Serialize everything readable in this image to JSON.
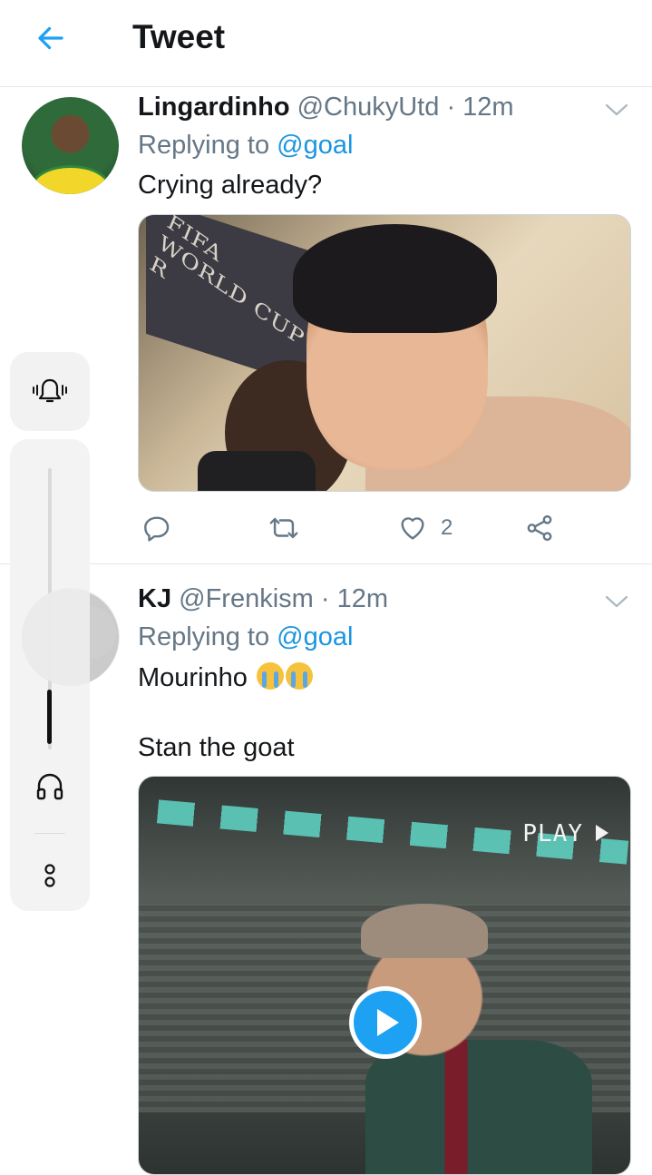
{
  "header": {
    "back_icon": "arrow-left-icon",
    "title": "Tweet",
    "accent": "#1da1f2"
  },
  "tweets": [
    {
      "name": "Lingardinho",
      "handle": "@ChukyUtd",
      "separator": "·",
      "time": "12m",
      "replying_prefix": "Replying to",
      "replying_to": "@goal",
      "text": "Crying already?",
      "media": {
        "type": "image",
        "sign_text": "FIFA WORLD CUP R"
      },
      "actions": {
        "reply_icon": "reply-icon",
        "retweet_icon": "retweet-icon",
        "like_icon": "heart-icon",
        "like_count": "2",
        "share_icon": "share-icon"
      }
    },
    {
      "name": "KJ",
      "handle": "@Frenkism",
      "separator": "·",
      "time": "12m",
      "replying_prefix": "Replying to",
      "replying_to": "@goal",
      "text_line1": "Mourinho",
      "emojis": [
        "crying-face-emoji",
        "crying-face-emoji"
      ],
      "text_line2": "Stan the goat",
      "media": {
        "type": "video",
        "overlay_label": "PLAY",
        "play_icon": "play-icon"
      }
    }
  ],
  "system_overlay": {
    "icons": [
      "bell-icon",
      "headset-icon",
      "more-icon"
    ],
    "volume_level": 0.2
  }
}
